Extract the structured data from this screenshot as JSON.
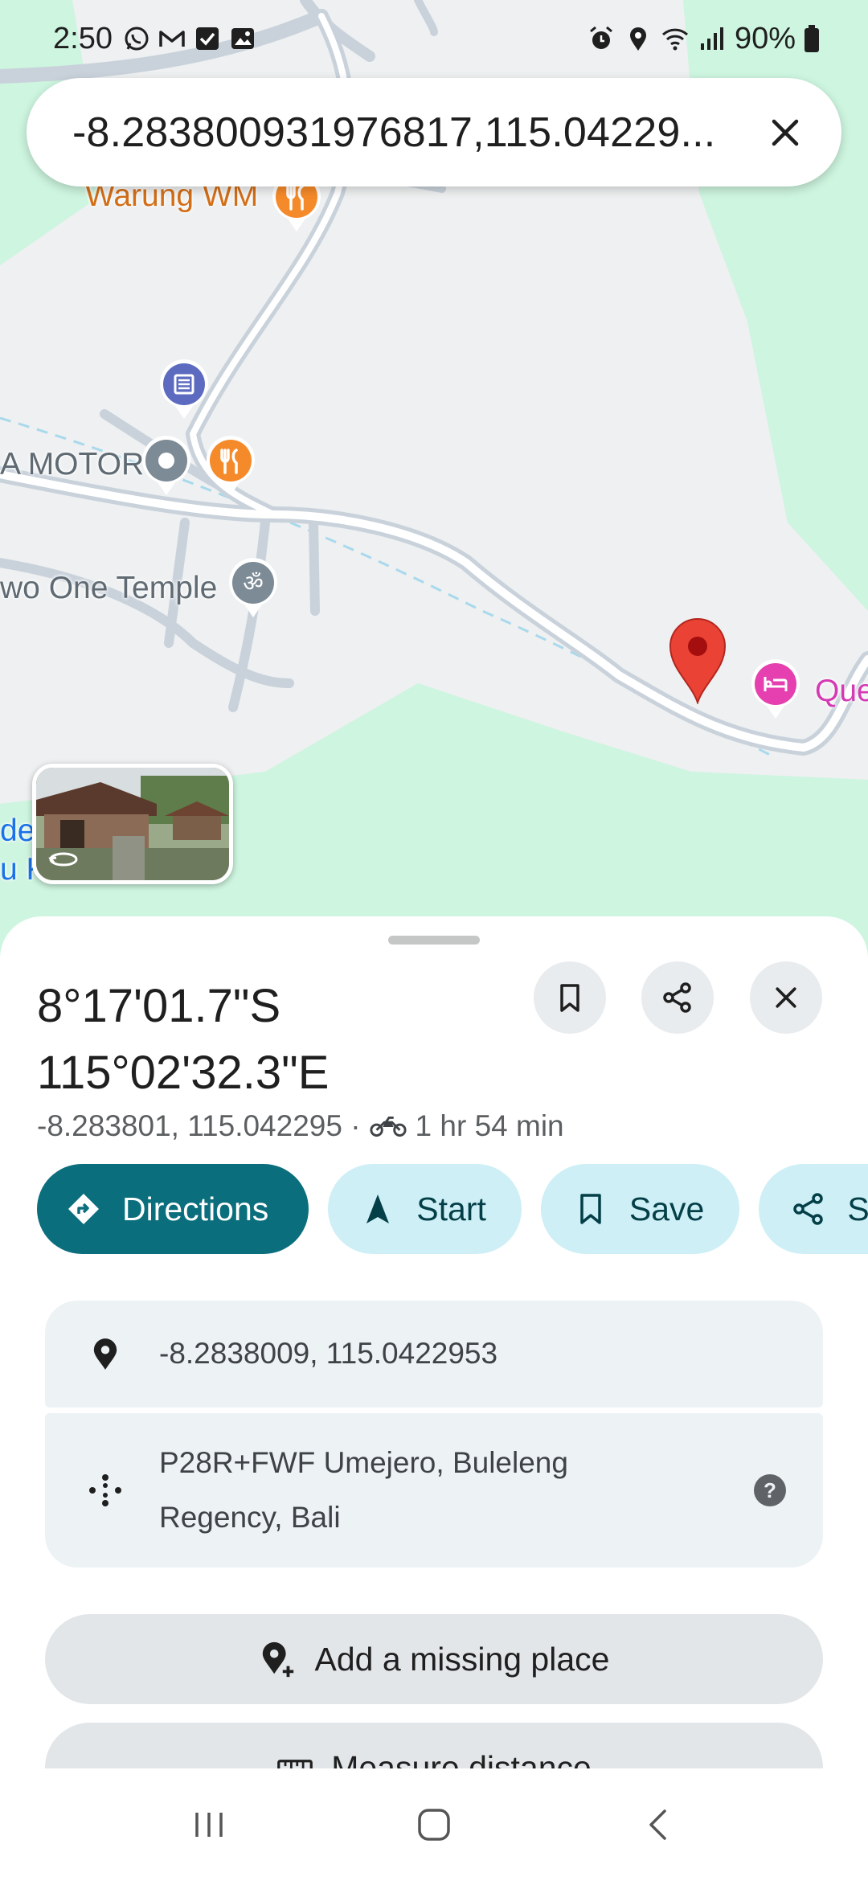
{
  "status_bar": {
    "time": "2:50",
    "battery": "90%",
    "left_icons": [
      "whatsapp-icon",
      "gmail-icon",
      "checkbox-icon",
      "gallery-icon"
    ],
    "right_icons": [
      "alarm-icon",
      "location-icon",
      "wifi-icon",
      "signal-icon",
      "battery-icon"
    ]
  },
  "search": {
    "query": "-8.283800931976817,115.04229..."
  },
  "map": {
    "labels": {
      "warung": "Warung WM",
      "motor": "A MOTOR",
      "temple": "wo One Temple",
      "hotel": "Que",
      "left_blue_1": "de",
      "left_blue_2": "u Ka"
    },
    "colors": {
      "land": "#eef0f1",
      "green": "#cdf5df",
      "road": "#c9d2db",
      "pin": "#ea4335"
    }
  },
  "place": {
    "title_line1": "8°17'01.7\"S",
    "title_line2": "115°02'32.3\"E",
    "coords_short": "-8.283801, 115.042295 ·",
    "travel_time": "1 hr 54 min"
  },
  "actions": {
    "directions": "Directions",
    "start": "Start",
    "save": "Save",
    "share": "Sh"
  },
  "info": {
    "latlng": "-8.2838009, 115.0422953",
    "pluscode_line1": "P28R+FWF Umejero, Buleleng",
    "pluscode_line2": "Regency, Bali"
  },
  "buttons": {
    "add_missing_place": "Add a missing place",
    "measure_distance": "Measure distance"
  }
}
